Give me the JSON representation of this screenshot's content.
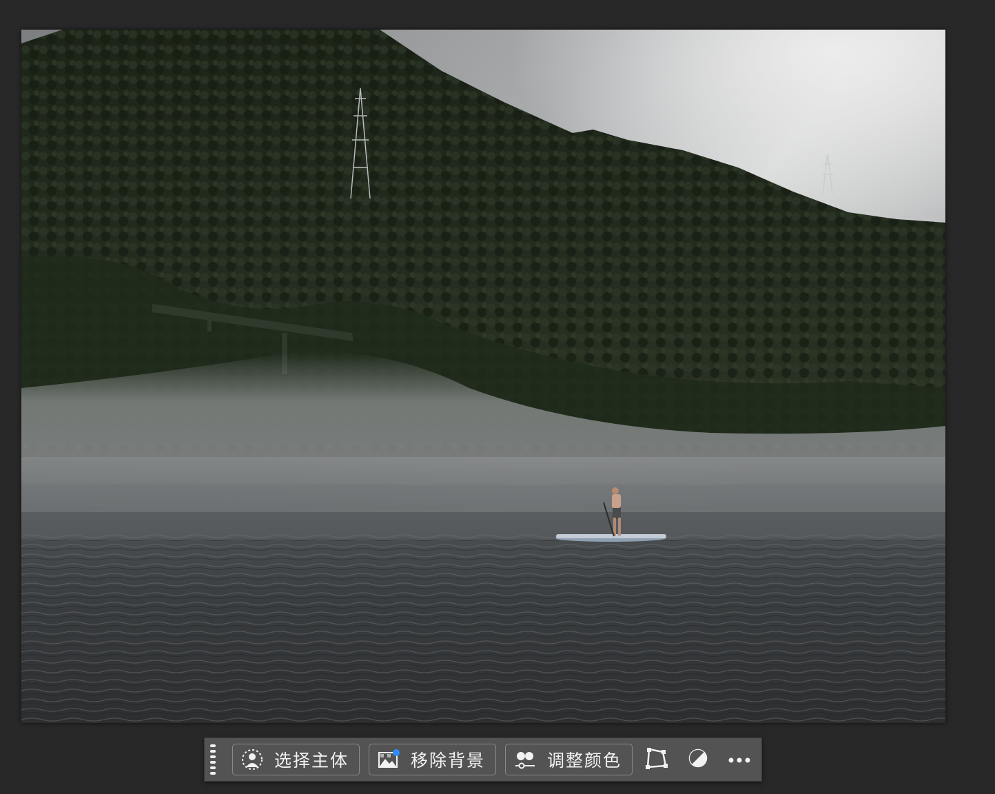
{
  "taskbar": {
    "select_subject_label": "选择主体",
    "remove_background_label": "移除背景",
    "adjust_color_label": "调整颜色",
    "icons": {
      "grip": "drag-handle-icon",
      "select_subject": "person-select-icon",
      "remove_background": "image-remove-bg-icon",
      "adjust_color": "adjust-color-icon",
      "transform": "transform-icon",
      "adjustment": "half-circle-icon",
      "more": "more-icon"
    }
  },
  "colors": {
    "workspace_bg": "#282828",
    "taskbar_bg": "#535353",
    "taskbar_text": "#f2f2f2",
    "accent_dot": "#2f8cff"
  }
}
